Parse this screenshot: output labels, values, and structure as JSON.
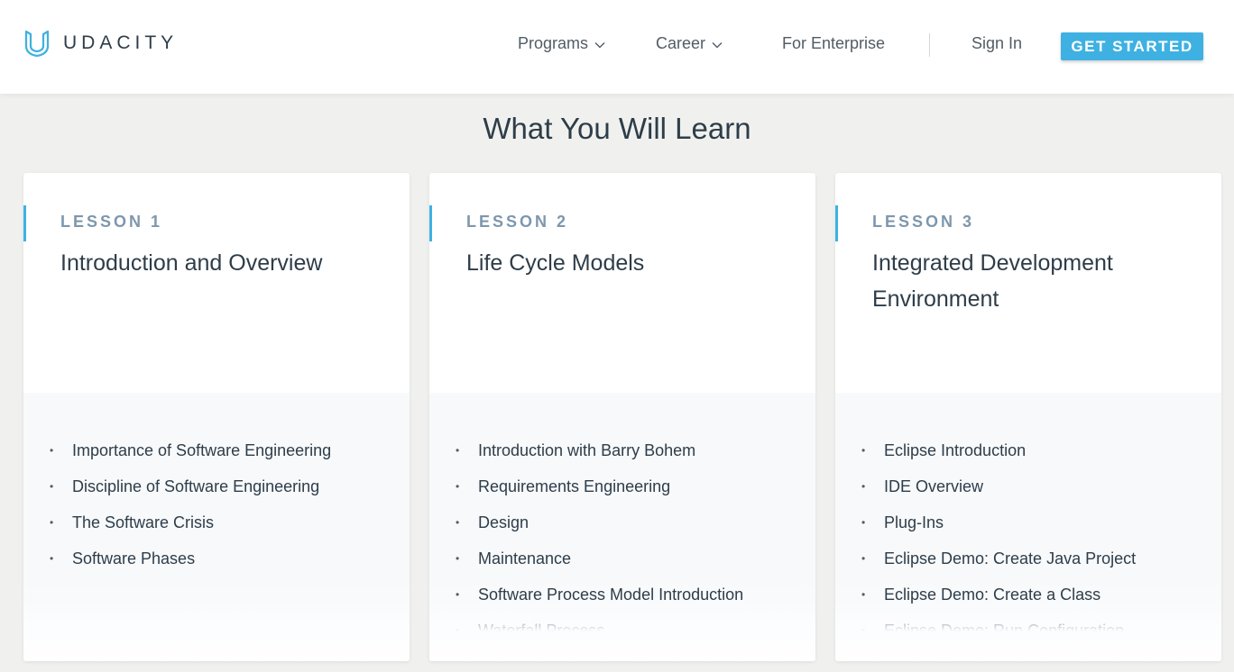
{
  "header": {
    "logo_text": "UDACITY",
    "nav": [
      {
        "label": "Programs",
        "has_dropdown": true
      },
      {
        "label": "Career",
        "has_dropdown": true
      },
      {
        "label": "For Enterprise",
        "has_dropdown": false
      }
    ],
    "sign_in": "Sign In",
    "cta": "GET STARTED"
  },
  "section_title": "What You Will Learn",
  "lessons": [
    {
      "label": "LESSON 1",
      "title": "Introduction and Overview",
      "topics": [
        "Importance of Software Engineering",
        "Discipline of Software Engineering",
        "The Software Crisis",
        "Software Phases"
      ]
    },
    {
      "label": "LESSON 2",
      "title": "Life Cycle Models",
      "topics": [
        "Introduction with Barry Bohem",
        "Requirements Engineering",
        "Design",
        "Maintenance",
        "Software Process Model Introduction",
        "Waterfall Process"
      ]
    },
    {
      "label": "LESSON 3",
      "title": "Integrated Development Environment",
      "topics": [
        "Eclipse Introduction",
        "IDE Overview",
        "Plug-Ins",
        "Eclipse Demo: Create Java Project",
        "Eclipse Demo: Create a Class",
        "Eclipse Demo: Run Configuration"
      ]
    }
  ],
  "colors": {
    "accent": "#3eb1e2",
    "text_dark": "#2e3d49",
    "lesson_label": "#7d97ad",
    "page_bg": "#f0f1ee"
  }
}
